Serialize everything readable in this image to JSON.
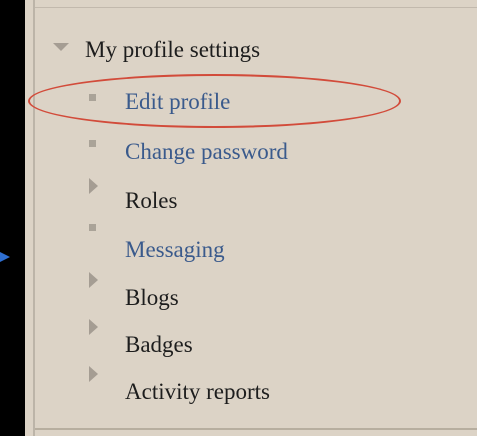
{
  "menu": {
    "parent": {
      "label": "My profile settings",
      "icon": "triangle-down-icon"
    },
    "items": [
      {
        "label": "Edit profile",
        "icon": "bullet-icon",
        "kind": "link"
      },
      {
        "label": "Change password",
        "icon": "bullet-icon",
        "kind": "link"
      },
      {
        "label": "Roles",
        "icon": "triangle-right-icon",
        "kind": "expandable"
      },
      {
        "label": "Messaging",
        "icon": "bullet-icon",
        "kind": "link"
      },
      {
        "label": "Blogs",
        "icon": "triangle-right-icon",
        "kind": "expandable"
      },
      {
        "label": "Badges",
        "icon": "triangle-right-icon",
        "kind": "expandable"
      },
      {
        "label": "Activity reports",
        "icon": "triangle-right-icon",
        "kind": "expandable"
      }
    ]
  },
  "annotation": {
    "highlight": "red-oval",
    "highlight_color": "#d24b3a",
    "pointer": "blue-arrow",
    "pointer_color": "#2f6fd1"
  },
  "colors": {
    "panel_bg": "#dcd3c6",
    "link_text": "#3a5a8c",
    "dark_text": "#1d1d1d",
    "icon_grey": "#a59d93"
  }
}
